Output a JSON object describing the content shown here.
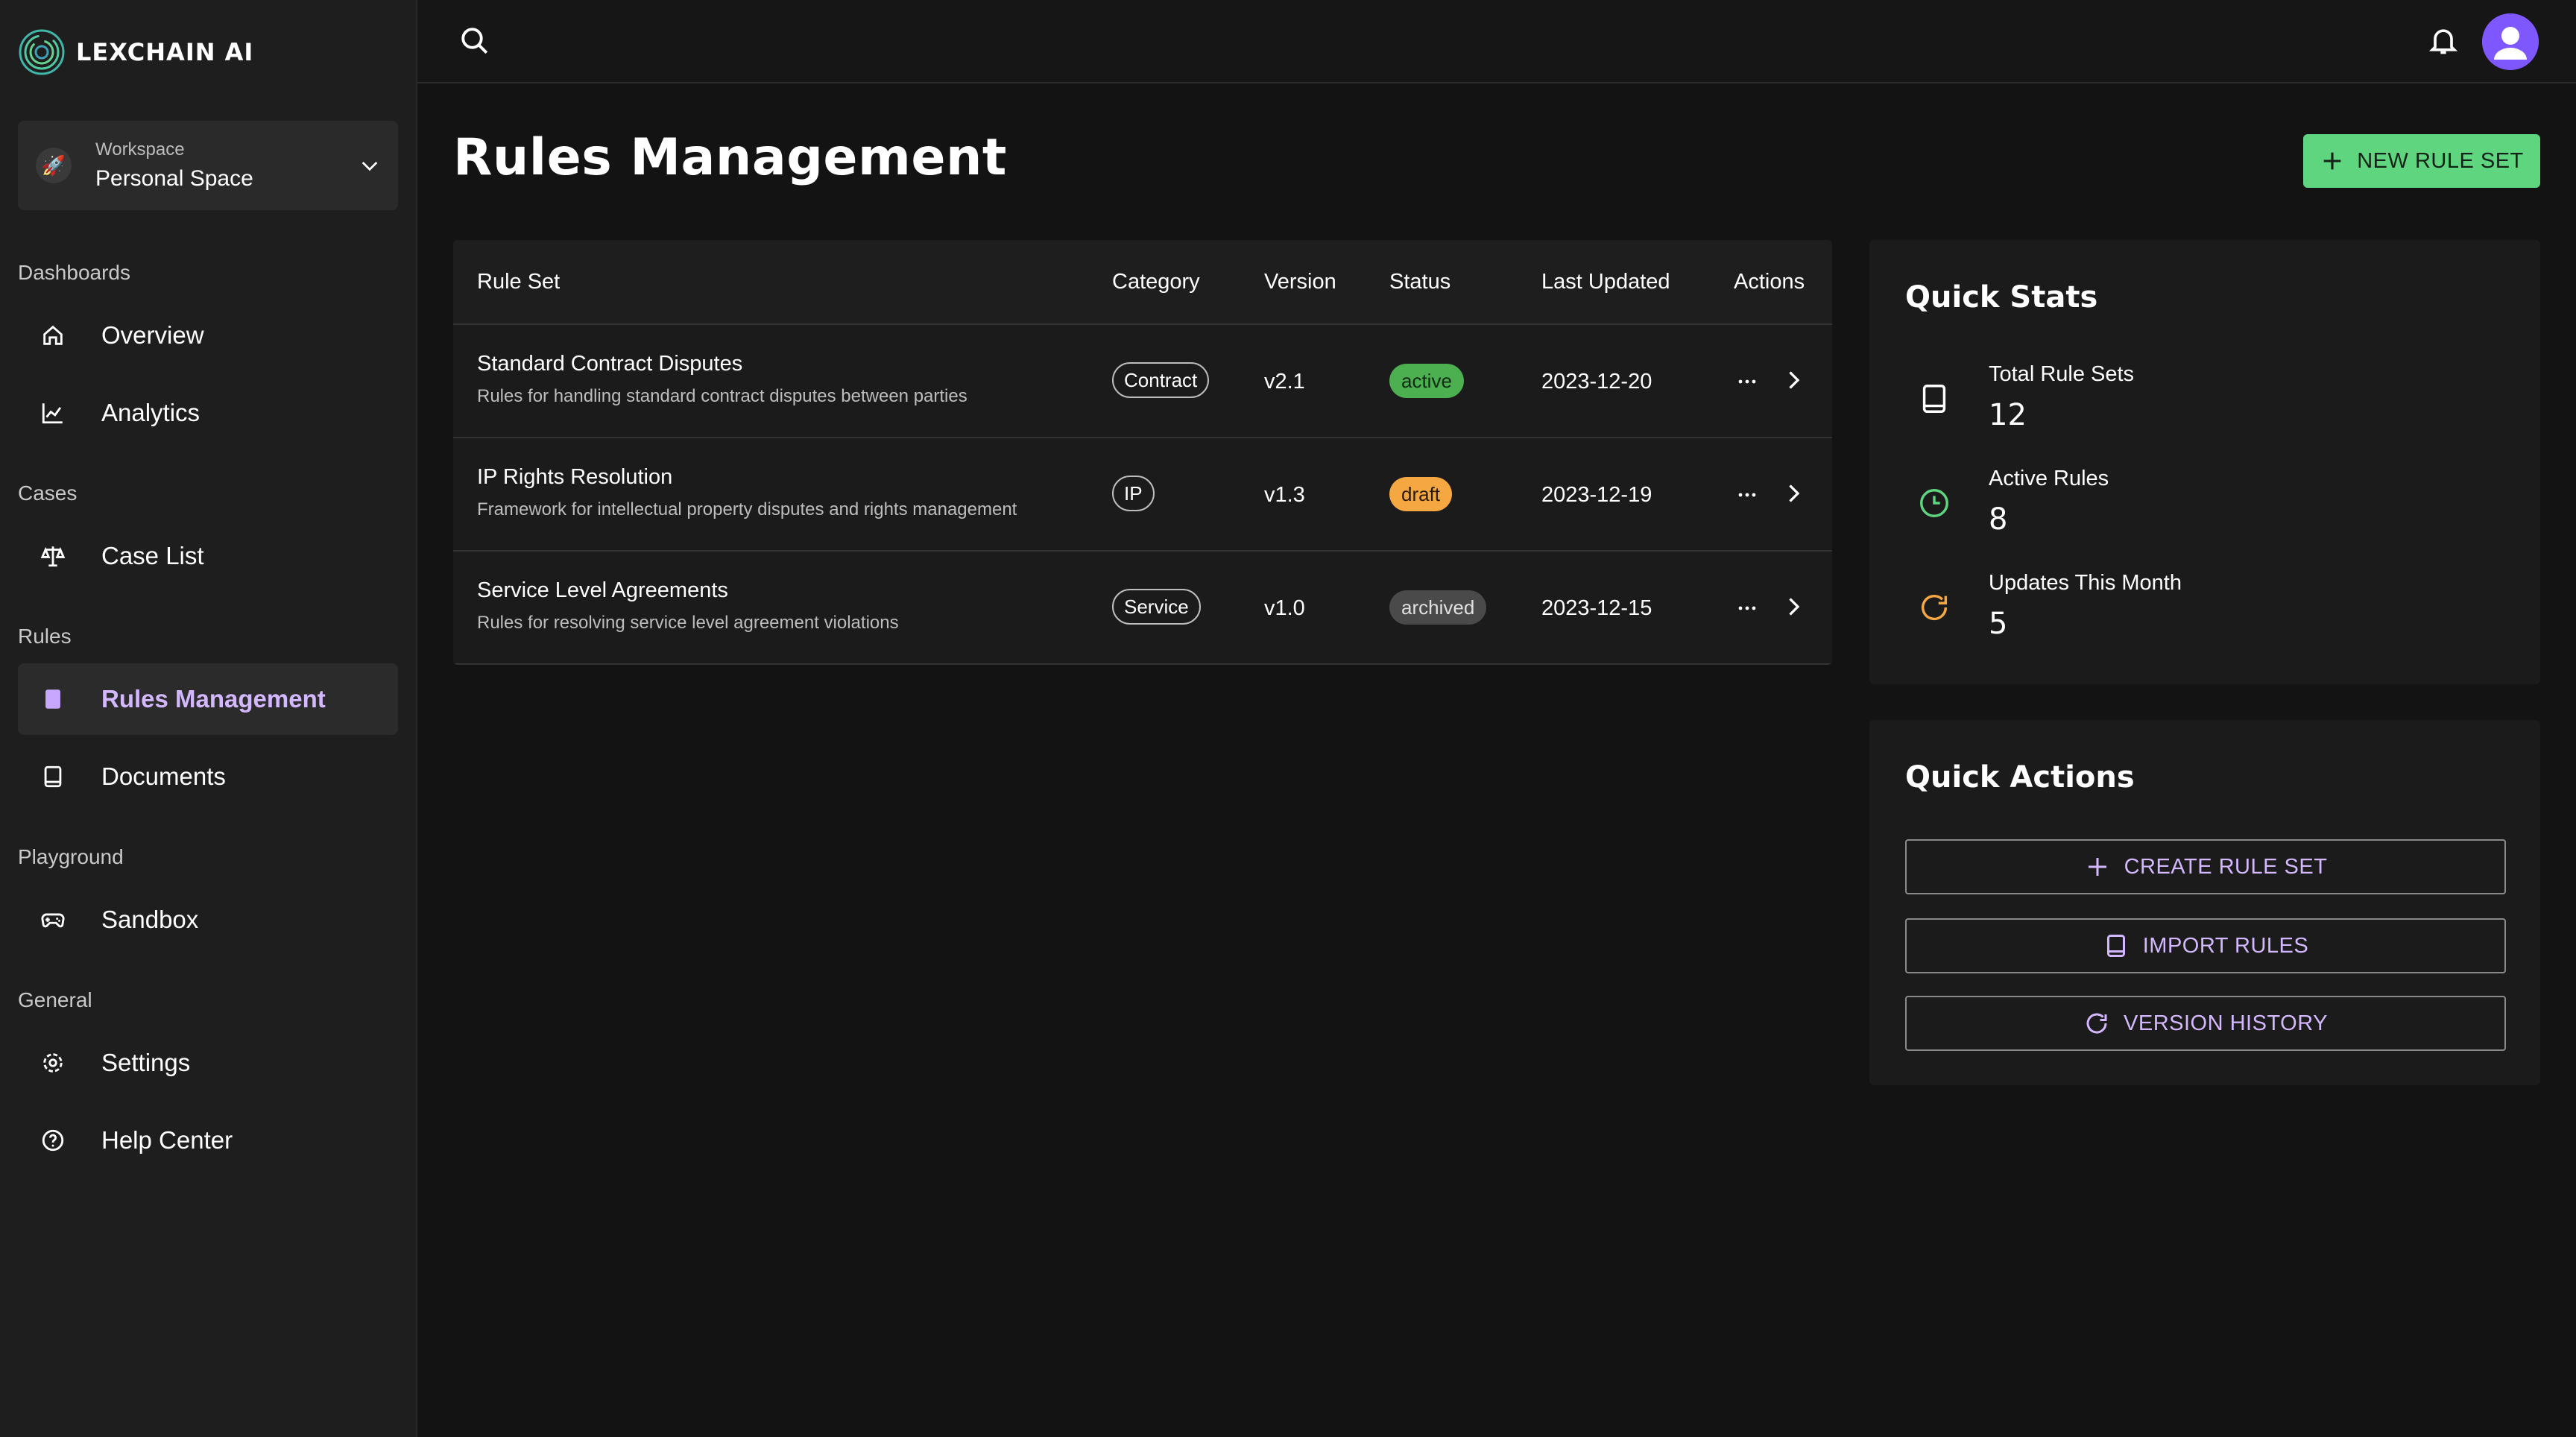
{
  "brand": {
    "name": "LEXCHAIN AI"
  },
  "workspace": {
    "label": "Workspace",
    "name": "Personal Space"
  },
  "sidebar": {
    "sections": [
      {
        "label": "Dashboards"
      },
      {
        "label": "Cases"
      },
      {
        "label": "Rules"
      },
      {
        "label": "Playground"
      },
      {
        "label": "General"
      }
    ],
    "items": [
      {
        "label": "Overview",
        "icon": "home-icon"
      },
      {
        "label": "Analytics",
        "icon": "chart-icon"
      },
      {
        "label": "Case List",
        "icon": "scale-icon"
      },
      {
        "label": "Rules Management",
        "icon": "book-icon",
        "active": true
      },
      {
        "label": "Documents",
        "icon": "document-icon"
      },
      {
        "label": "Sandbox",
        "icon": "gamepad-icon"
      },
      {
        "label": "Settings",
        "icon": "gear-icon"
      },
      {
        "label": "Help Center",
        "icon": "help-icon"
      }
    ]
  },
  "page": {
    "title": "Rules Management",
    "new_button": "NEW RULE SET"
  },
  "table": {
    "headers": [
      "Rule Set",
      "Category",
      "Version",
      "Status",
      "Last Updated",
      "Actions"
    ],
    "rows": [
      {
        "title": "Standard Contract Disputes",
        "desc": "Rules for handling standard contract disputes between parties",
        "category": "Contract",
        "version": "v2.1",
        "status": "active",
        "updated": "2023-12-20"
      },
      {
        "title": "IP Rights Resolution",
        "desc": "Framework for intellectual property disputes and rights management",
        "category": "IP",
        "version": "v1.3",
        "status": "draft",
        "updated": "2023-12-19"
      },
      {
        "title": "Service Level Agreements",
        "desc": "Rules for resolving service level agreement violations",
        "category": "Service",
        "version": "v1.0",
        "status": "archived",
        "updated": "2023-12-15"
      }
    ]
  },
  "quick_stats": {
    "title": "Quick Stats",
    "items": [
      {
        "label": "Total Rule Sets",
        "value": "12",
        "icon": "book-icon"
      },
      {
        "label": "Active Rules",
        "value": "8",
        "icon": "clock-icon"
      },
      {
        "label": "Updates This Month",
        "value": "5",
        "icon": "refresh-icon"
      }
    ]
  },
  "quick_actions": {
    "title": "Quick Actions",
    "buttons": [
      {
        "label": "CREATE RULE SET",
        "icon": "plus-icon"
      },
      {
        "label": "IMPORT RULES",
        "icon": "book-icon"
      },
      {
        "label": "VERSION HISTORY",
        "icon": "refresh-icon"
      }
    ]
  },
  "colors": {
    "accent_green": "#5fd580",
    "accent_purple": "#d4b8ff",
    "status_active": "#4caf50",
    "status_draft": "#f5a742",
    "status_archived": "#4a4a4a"
  }
}
